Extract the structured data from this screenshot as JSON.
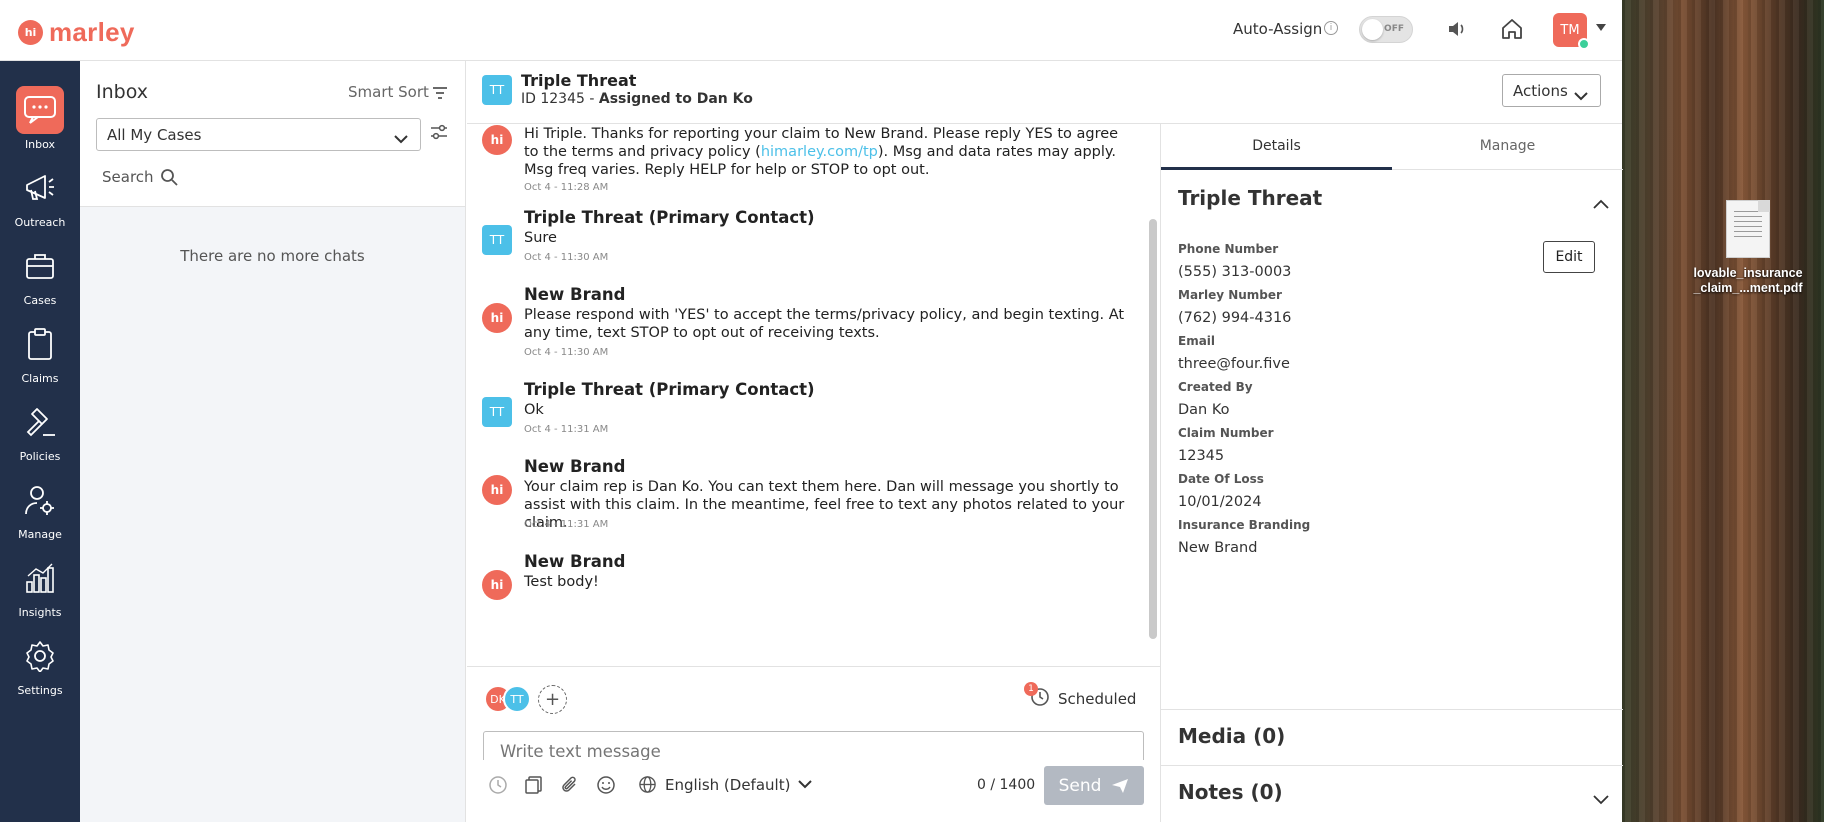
{
  "brand": {
    "logo_mark": "hi",
    "logo_text": "marley",
    "accent": "#ef6a5a",
    "nav_bg": "#22304a",
    "contact_color": "#4cc0e8"
  },
  "topbar": {
    "auto_assign_label": "Auto-Assign",
    "toggle_state": "OFF",
    "user_initials": "TM"
  },
  "nav": [
    {
      "label": "Inbox",
      "icon": "chat-bubble-icon"
    },
    {
      "label": "Outreach",
      "icon": "megaphone-icon"
    },
    {
      "label": "Cases",
      "icon": "briefcase-icon"
    },
    {
      "label": "Claims",
      "icon": "clipboard-icon"
    },
    {
      "label": "Policies",
      "icon": "gavel-icon"
    },
    {
      "label": "Manage",
      "icon": "user-gear-icon"
    },
    {
      "label": "Insights",
      "icon": "bar-chart-icon"
    },
    {
      "label": "Settings",
      "icon": "gear-icon"
    }
  ],
  "inbox": {
    "title": "Inbox",
    "smart_sort": "Smart Sort",
    "filter_value": "All My Cases",
    "search_label": "Search",
    "empty_text": "There are no more chats"
  },
  "conversation": {
    "badge": "TT",
    "title": "Triple Threat",
    "id_text": "ID 12345 - ",
    "assigned_text": "Assigned to Dan Ko",
    "actions_label": "Actions",
    "messages": [
      {
        "sender": "",
        "body_pre": "Hi Triple. Thanks for reporting your claim to New Brand. Please reply YES to agree to the terms and privacy policy (",
        "link": "himarley.com/tp",
        "body_post": "). Msg and data rates may apply. Msg freq varies. Reply HELP for help or STOP to opt out.",
        "time": "Oct 4 - 11:28 AM"
      },
      {
        "sender": "Triple Threat (Primary Contact)",
        "body": "Sure",
        "time": "Oct 4 - 11:30 AM",
        "avatar": "TT"
      },
      {
        "sender": "New Brand",
        "body": "Please respond with 'YES' to accept the terms/privacy policy, and begin texting. At any time, text STOP to opt out of receiving texts.",
        "time": "Oct 4 - 11:30 AM",
        "avatar": "hi"
      },
      {
        "sender": "Triple Threat (Primary Contact)",
        "body": "Ok",
        "time": "Oct 4 - 11:31 AM",
        "avatar": "TT"
      },
      {
        "sender": "New Brand",
        "body": "Your claim rep is Dan Ko. You can text them here. Dan will message you shortly to assist with this claim. In the meantime, feel free to text any photos related to your claim.",
        "time": "Oct 4 - 11:31 AM",
        "avatar": "hi"
      },
      {
        "sender": "New Brand",
        "body": "Test body!",
        "time": "",
        "avatar": "hi"
      }
    ]
  },
  "composer": {
    "participants": [
      "DK",
      "TT"
    ],
    "scheduled_count": "1",
    "scheduled_label": "Scheduled",
    "placeholder": "Write text message",
    "language": "English (Default)",
    "char_count": "0 / 1400",
    "send_label": "Send"
  },
  "details": {
    "tab_details": "Details",
    "tab_manage": "Manage",
    "contact_name": "Triple Threat",
    "edit_label": "Edit",
    "fields": [
      {
        "label": "Phone Number",
        "value": "(555) 313-0003"
      },
      {
        "label": "Marley Number",
        "value": "(762) 994-4316"
      },
      {
        "label": "Email",
        "value": "three@four.five"
      },
      {
        "label": "Created By",
        "value": "Dan Ko"
      },
      {
        "label": "Claim Number",
        "value": "12345"
      },
      {
        "label": "Date Of Loss",
        "value": "10/01/2024"
      },
      {
        "label": "Insurance Branding",
        "value": "New Brand"
      }
    ],
    "media_title": "Media (0)",
    "notes_title": "Notes (0)"
  },
  "desktop": {
    "file_name_1": "lovable_insurance",
    "file_name_2": "_claim_...ment.pdf"
  }
}
